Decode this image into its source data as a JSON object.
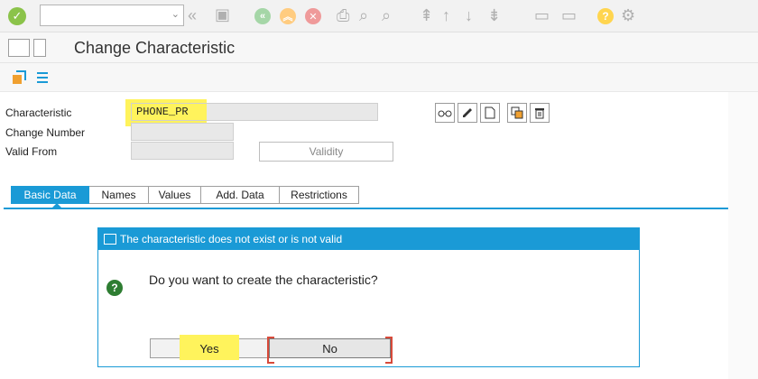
{
  "window": {
    "title": "Change Characteristic"
  },
  "form": {
    "characteristic_label": "Characteristic",
    "characteristic_value": "PHONE_PR",
    "change_number_label": "Change Number",
    "change_number_value": "",
    "valid_from_label": "Valid From",
    "valid_from_value": "",
    "validity_button": "Validity"
  },
  "tabs": [
    {
      "label": "Basic Data",
      "active": true
    },
    {
      "label": "Names",
      "active": false
    },
    {
      "label": "Values",
      "active": false
    },
    {
      "label": "Add. Data",
      "active": false
    },
    {
      "label": "Restrictions",
      "active": false
    }
  ],
  "dialog": {
    "title": "The characteristic does not exist or is not valid",
    "message": "Do you want to create the characteristic?",
    "yes_label": "Yes",
    "no_label": "No"
  },
  "colors": {
    "accent": "#1a9ad6",
    "highlight": "#fff35c",
    "question_icon": "#2e7d32"
  }
}
